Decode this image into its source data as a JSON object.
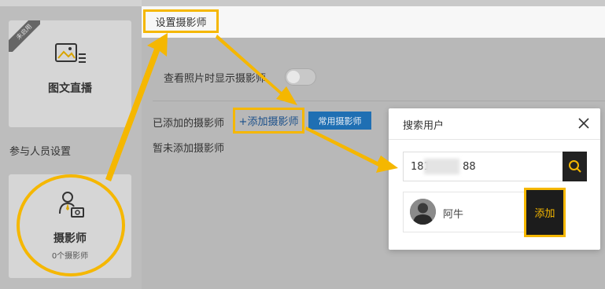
{
  "sidebar": {
    "tuwen_card": {
      "ribbon": "未启用",
      "title": "图文直播",
      "icon": "image-text-icon"
    },
    "section_label": "参与人员设置",
    "photographer_card": {
      "title": "摄影师",
      "count": "0个摄影师",
      "icon": "photographer-icon"
    }
  },
  "panel": {
    "title": "设置摄影师",
    "toggle_label": "查看照片时显示摄影师",
    "toggle_on": false,
    "added_label": "已添加的摄影师",
    "add_button": "+添加摄影师",
    "common_button": "常用摄影师",
    "empty_text": "暂未添加摄影师"
  },
  "modal": {
    "title": "搜索用户",
    "close_icon": "close-icon",
    "search_value": "181          88",
    "search_icon": "search-icon",
    "result": {
      "name": "阿牛",
      "add_label": "添加"
    }
  },
  "colors": {
    "highlight": "#f5b700",
    "primary_button": "#1f6fb3",
    "dark_button": "#1c1c1c"
  }
}
